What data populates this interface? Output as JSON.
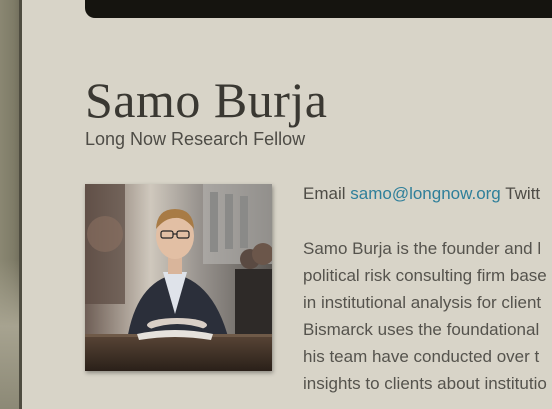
{
  "header": {
    "name": "Samo Burja",
    "title": "Long Now Research Fellow"
  },
  "profile_photo": {
    "alt": "Samo Burja"
  },
  "contact": {
    "email_label": "Email",
    "email": "samo@longnow.org",
    "twitter_label": "Twitt"
  },
  "bio_lines": [
    "Samo Burja is the founder and l",
    "political risk consulting firm base",
    "in institutional analysis for client",
    "Bismarck uses the foundational",
    "his team have conducted over t",
    "insights to clients about institutio"
  ],
  "colors": {
    "background": "#d8d4c8",
    "heading": "#3a3832",
    "link": "#2f7f9a",
    "top_bar": "#15140f"
  }
}
